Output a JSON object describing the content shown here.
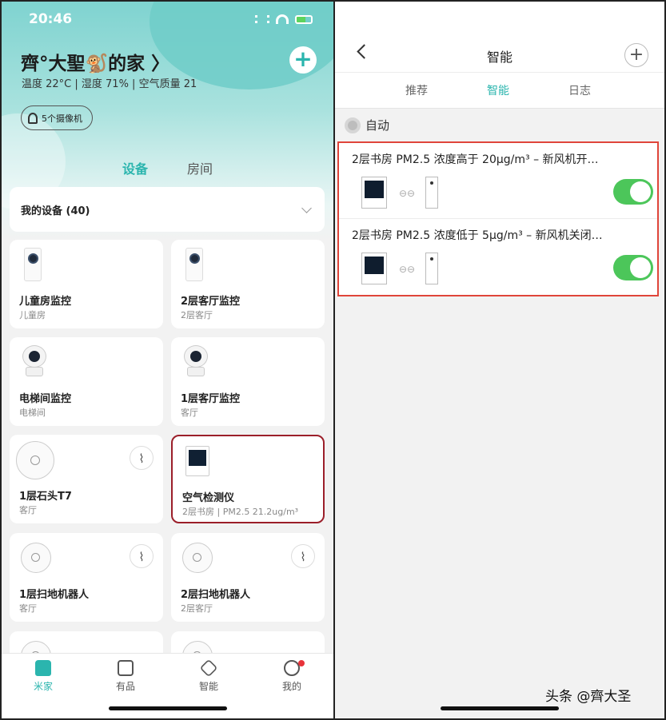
{
  "left": {
    "status_time": "20:46",
    "home_title": "齊°大聖🐒的家 〉",
    "add_label": "+",
    "home_sub": "温度 22°C | 湿度 71% | 空气质量 21",
    "camera_pill": "5个摄像机",
    "seg_devices": "设备",
    "seg_rooms": "房间",
    "my_devices": "我的设备 (40)",
    "devices": [
      {
        "name": "儿童房监控",
        "room": "儿童房"
      },
      {
        "name": "2层客厅监控",
        "room": "2层客厅"
      },
      {
        "name": "电梯间监控",
        "room": "电梯间"
      },
      {
        "name": "1层客厅监控",
        "room": "客厅"
      },
      {
        "name": "1层石头T7",
        "room": "客厅"
      },
      {
        "name": "空气检测仪",
        "room": "2层书房 | PM2.5 21.2ug/m³"
      },
      {
        "name": "1层扫地机器人",
        "room": "客厅"
      },
      {
        "name": "2层扫地机器人",
        "room": "2层客厅"
      }
    ],
    "tabs": [
      "米家",
      "有品",
      "智能",
      "我的"
    ]
  },
  "right": {
    "title": "智能",
    "plus": "+",
    "tabs": [
      "推荐",
      "智能",
      "日志"
    ],
    "auto_label": "自动",
    "rules": [
      {
        "text": "2层书房 PM2.5 浓度高于 20μg/m³ – 新风机开…",
        "enabled": true
      },
      {
        "text": "2层书房 PM2.5 浓度低于 5μg/m³ – 新风机关闭…",
        "enabled": true
      }
    ],
    "watermark": "头条 @齊大圣",
    "accent": "#2bb5ae",
    "toggle_color": "#4cc65a"
  }
}
